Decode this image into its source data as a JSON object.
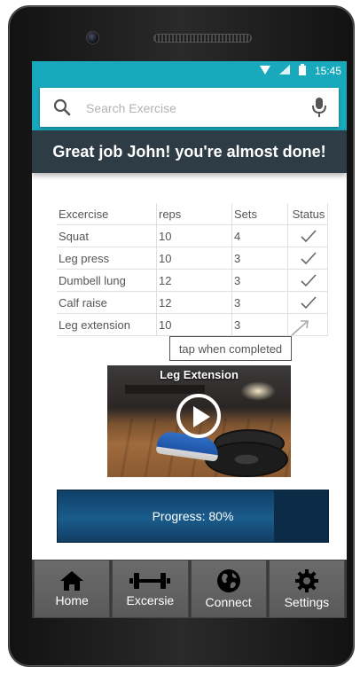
{
  "status_bar": {
    "time": "15:45",
    "icons": [
      "wifi-icon",
      "signal-icon",
      "battery-icon"
    ]
  },
  "search": {
    "placeholder": "Search Exercise",
    "icons": [
      "search-icon",
      "microphone-icon"
    ]
  },
  "banner": {
    "text": "Great job John! you're almost done!"
  },
  "table": {
    "headers": [
      "Excercise",
      "reps",
      "Sets",
      "Status"
    ],
    "rows": [
      {
        "exercise": "Squat",
        "reps": "10",
        "sets": "4",
        "status": "completed"
      },
      {
        "exercise": "Leg press",
        "reps": "10",
        "sets": "3",
        "status": "completed"
      },
      {
        "exercise": "Dumbell lung",
        "reps": "12",
        "sets": "3",
        "status": "completed"
      },
      {
        "exercise": "Calf raise",
        "reps": "12",
        "sets": "3",
        "status": "completed"
      },
      {
        "exercise": "Leg extension",
        "reps": "10",
        "sets": "3",
        "status": "pending"
      }
    ]
  },
  "tooltip": {
    "text": "tap when completed"
  },
  "video": {
    "title": "Leg Extension",
    "icon": "play-icon"
  },
  "progress": {
    "label": "Progress: 80%",
    "fraction": 0.8
  },
  "nav": {
    "items": [
      {
        "label": "Home",
        "icon": "home-icon"
      },
      {
        "label": "Excersie",
        "icon": "dumbbell-icon"
      },
      {
        "label": "Connect",
        "icon": "globe-icon"
      },
      {
        "label": "Settings",
        "icon": "gear-icon"
      }
    ]
  },
  "colors": {
    "accent": "#18a9bd",
    "banner": "#2e3d45",
    "progress_bg": "#0b2b47",
    "nav_bg": "#5a5a5a"
  }
}
